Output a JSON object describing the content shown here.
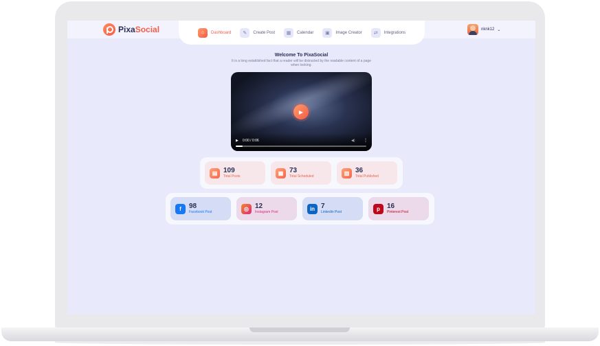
{
  "brand": {
    "name_part1": "Pixa",
    "name_part2": "Social"
  },
  "nav": [
    {
      "label": "Dashboard",
      "icon": "home-icon",
      "active": true
    },
    {
      "label": "Create Post",
      "icon": "edit-icon",
      "active": false
    },
    {
      "label": "Calendar",
      "icon": "calendar-icon",
      "active": false
    },
    {
      "label": "Image Creator",
      "icon": "image-icon",
      "active": false
    },
    {
      "label": "Integrations",
      "icon": "integrations-icon",
      "active": false
    }
  ],
  "user": {
    "name": "nknk12"
  },
  "welcome": {
    "title": "Welcome To PixaSocial",
    "subtitle": "It is a long established fact that a reader will be distracted by the readable content of a page when looking."
  },
  "video": {
    "time": "0:00 / 0:06",
    "progress": 0.05
  },
  "stats": [
    {
      "value": "109",
      "label": "Total Posts",
      "icon": "posts-icon"
    },
    {
      "value": "73",
      "label": "Total Scheduled",
      "icon": "scheduled-icon"
    },
    {
      "value": "36",
      "label": "Total Published",
      "icon": "published-icon"
    }
  ],
  "social": [
    {
      "value": "98",
      "label": "Facebook Post",
      "icon": "facebook-icon",
      "color": "#1877f2"
    },
    {
      "value": "12",
      "label": "Instagram Post",
      "icon": "instagram-icon",
      "color": "#dd2a7b"
    },
    {
      "value": "7",
      "label": "Linkedin Post",
      "icon": "linkedin-icon",
      "color": "#0a66c2"
    },
    {
      "value": "16",
      "label": "Pinterest Post",
      "icon": "pinterest-icon",
      "color": "#bd081c"
    }
  ],
  "colors": {
    "accent": "#f45d48",
    "background": "#e8e9fb",
    "text": "#2b2f55"
  }
}
